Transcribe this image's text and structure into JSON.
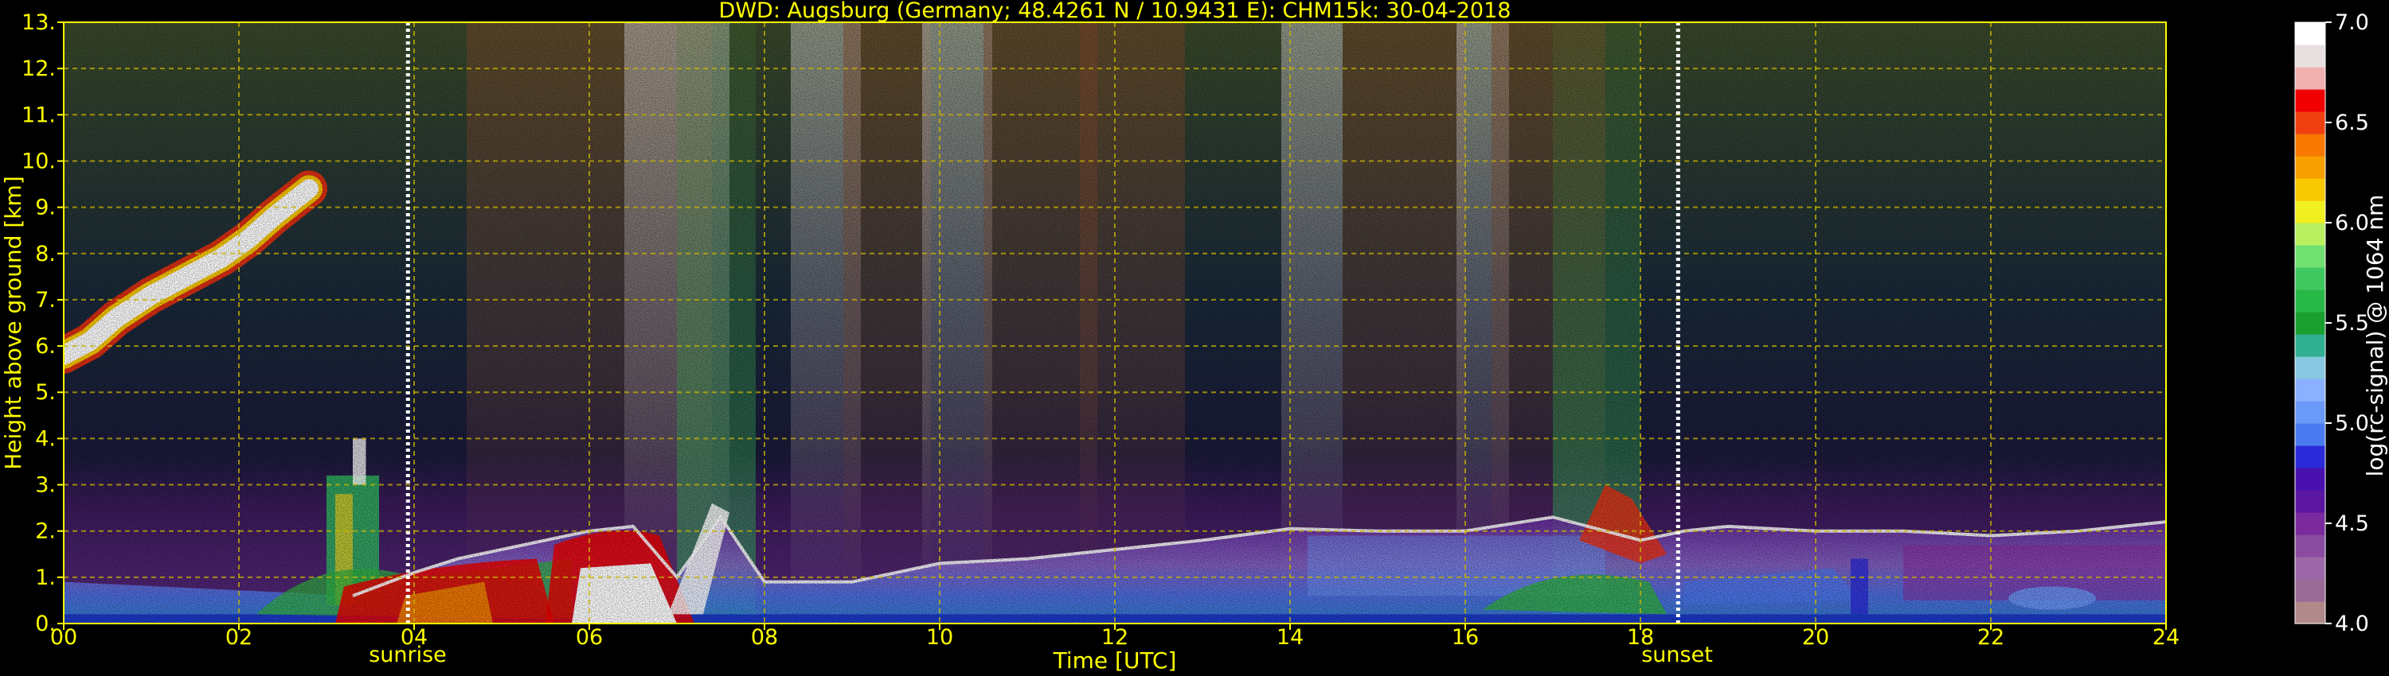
{
  "chart_data": {
    "type": "heatmap",
    "title": "DWD: Augsburg (Germany; 48.4261 N / 10.9431 E):    CHM15k: 30-04-2018",
    "xlabel": "Time [UTC]",
    "ylabel": "Height above ground [km]",
    "xlim": [
      0,
      24
    ],
    "ylim": [
      0,
      13
    ],
    "x_ticks": [
      "00",
      "02",
      "04",
      "06",
      "08",
      "10",
      "12",
      "14",
      "16",
      "18",
      "20",
      "22",
      "24"
    ],
    "y_ticks": [
      "0.",
      "1.",
      "2.",
      "3.",
      "4.",
      "5.",
      "6.",
      "7.",
      "8.",
      "9.",
      "10.",
      "11.",
      "12.",
      "13."
    ],
    "grid": true,
    "colorbar": {
      "label": "log(rc-signal) @ 1064 nm",
      "range": [
        4.0,
        7.0
      ],
      "ticks": [
        "4.0",
        "4.5",
        "5.0",
        "5.5",
        "6.0",
        "6.5",
        "7.0"
      ],
      "colors": [
        "#b08a8a",
        "#9a6b96",
        "#9c68a8",
        "#8a4ca0",
        "#7a2a9c",
        "#5a16a0",
        "#4a10b0",
        "#2a2ad8",
        "#4a7af0",
        "#6a9af8",
        "#8ab0ff",
        "#88c8e0",
        "#30b090",
        "#1aa030",
        "#28b848",
        "#40c860",
        "#70e070",
        "#b8f060",
        "#f0f020",
        "#f8c800",
        "#f8a000",
        "#f87800",
        "#f04010",
        "#f00000",
        "#f0b0b0",
        "#e8e0e0",
        "#ffffff"
      ]
    },
    "events": [
      {
        "label": "sunrise",
        "time_utc": 3.93
      },
      {
        "label": "sunset",
        "time_utc": 18.43
      }
    ],
    "layers": [
      {
        "name": "elevated cloud",
        "x": [
          0,
          0.3,
          0.6,
          1.0,
          1.4,
          1.8,
          2.1,
          2.4,
          2.8
        ],
        "y": [
          5.8,
          6.1,
          6.6,
          7.1,
          7.5,
          7.9,
          8.3,
          8.8,
          9.4
        ]
      },
      {
        "name": "boundary layer top",
        "x": [
          3.3,
          4.0,
          4.5,
          5.0,
          5.5,
          6.0,
          6.5,
          7.0,
          7.5,
          8.0,
          9.0,
          10.0,
          11.0,
          12.0,
          13.0,
          14.0,
          15.0,
          16.0,
          17.0,
          18.0,
          18.5,
          19.0,
          20.0,
          21.0,
          22.0,
          23.0,
          24.0
        ],
        "y": [
          0.6,
          1.1,
          1.4,
          1.6,
          1.8,
          2.0,
          2.1,
          1.0,
          2.3,
          0.9,
          0.9,
          1.3,
          1.4,
          1.6,
          1.8,
          2.05,
          2.0,
          2.0,
          2.3,
          1.8,
          2.0,
          2.1,
          2.0,
          2.0,
          1.9,
          2.0,
          2.2
        ]
      }
    ]
  }
}
